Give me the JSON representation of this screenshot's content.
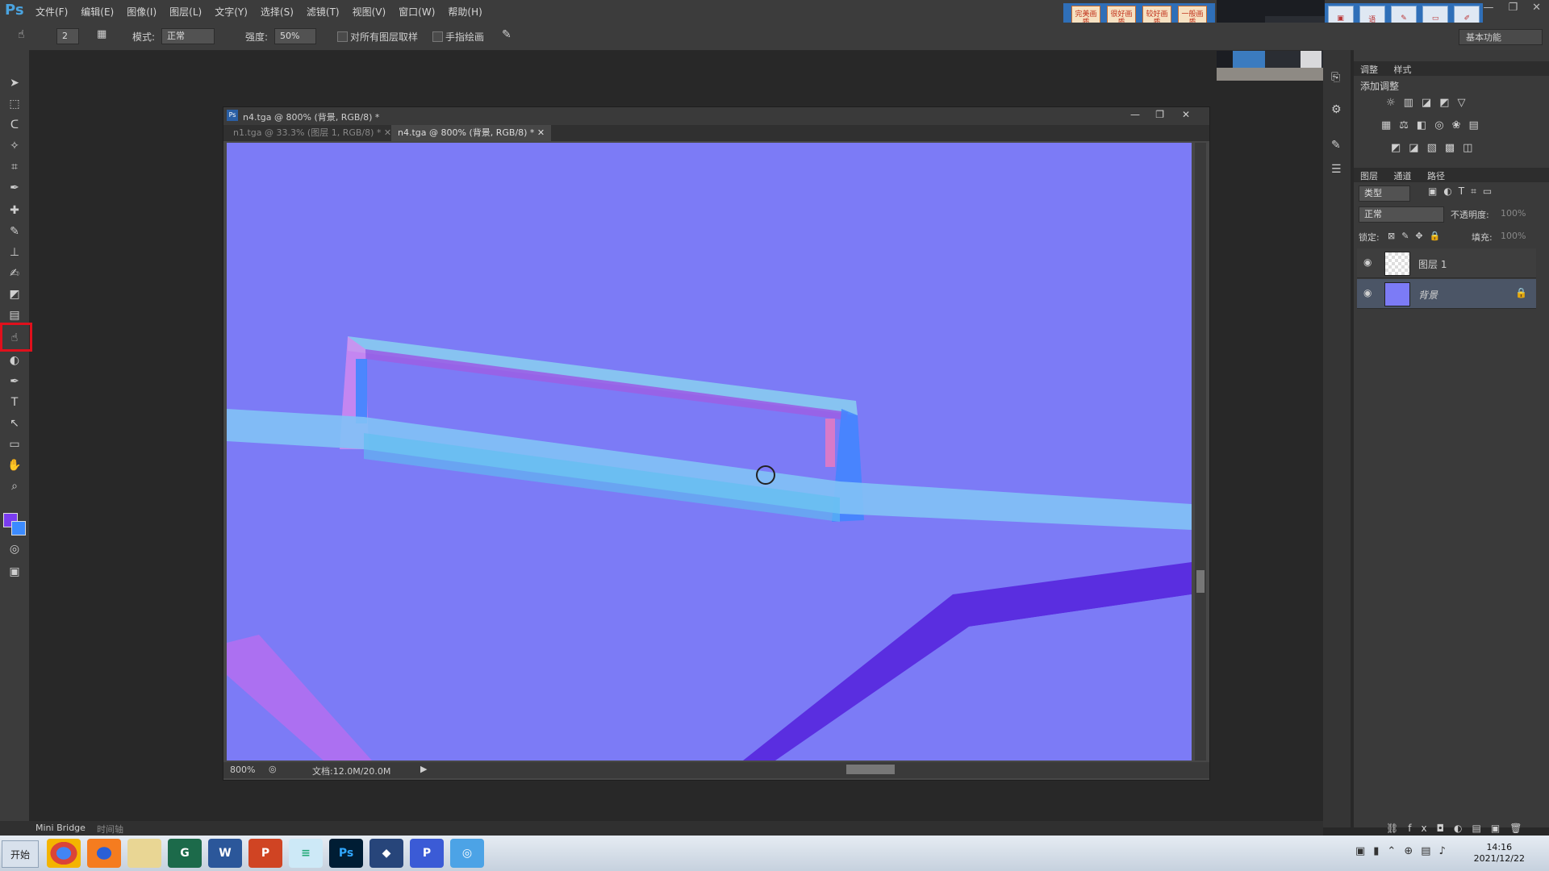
{
  "app": {
    "logo": "Ps"
  },
  "menu": [
    "文件(F)",
    "编辑(E)",
    "图像(I)",
    "图层(L)",
    "文字(Y)",
    "选择(S)",
    "滤镜(T)",
    "视图(V)",
    "窗口(W)",
    "帮助(H)"
  ],
  "window_controls": {
    "minimize": "—",
    "restore": "❐",
    "close": "✕"
  },
  "ad_buttons": [
    "完美画质",
    "很好画质",
    "较好画质",
    "一般画质"
  ],
  "right_buttons": [
    "自适应",
    "语音广播",
    "画笔",
    "屏幕",
    "书写"
  ],
  "options": {
    "brush_size": "2",
    "mode_label": "模式:",
    "mode_value": "正常",
    "strength_label": "强度:",
    "strength_value": "50%",
    "sample_all_label": "对所有图层取样",
    "finger_paint_label": "手指绘画",
    "workspace": "基本功能"
  },
  "document": {
    "window_title": "n4.tga @ 800% (背景, RGB/8) *",
    "tabs": [
      "n1.tga @ 33.3% (图层 1, RGB/8) *",
      "n4.tga @ 800% (背景, RGB/8) *"
    ],
    "zoom": "800%",
    "doc_info": "文档:12.0M/20.0M"
  },
  "panels": {
    "adjust_tabs": [
      "调整",
      "样式"
    ],
    "adjust_title": "添加调整",
    "layer_tabs": [
      "图层",
      "通道",
      "路径"
    ],
    "filter_kind": "类型",
    "blend_mode": "正常",
    "opacity_label": "不透明度:",
    "opacity_value": "100%",
    "lock_label": "锁定:",
    "fill_label": "填充:",
    "fill_value": "100%",
    "layers": [
      {
        "name": "图层 1",
        "visible": true,
        "selected": false
      },
      {
        "name": "背景",
        "visible": true,
        "selected": true,
        "locked": true
      }
    ]
  },
  "bottom_tabs": [
    "Mini Bridge",
    "时间轴"
  ],
  "taskbar": {
    "start": "开始",
    "apps": [
      "chrome-icon",
      "firefox-icon",
      "explorer-icon",
      "app-icon",
      "word-icon",
      "powerpoint-icon",
      "notepad-icon",
      "photoshop-icon",
      "app2-icon",
      "app3-icon",
      "app4-icon"
    ],
    "time": "14:16",
    "date": "2021/12/22"
  },
  "colors": {
    "canvas": "#7c7bf6",
    "foreground": "#7a3cf0",
    "background": "#3c8bff",
    "highlight": "#e0101c"
  }
}
